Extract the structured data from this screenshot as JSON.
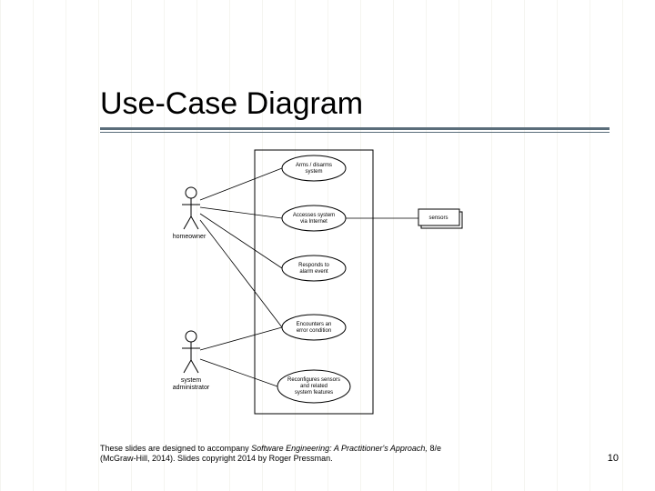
{
  "title": "Use-Case Diagram",
  "actors": {
    "homeowner": "homeowner",
    "sysadmin_line1": "system",
    "sysadmin_line2": "administrator"
  },
  "usecases": {
    "uc1_l1": "Arms / disarms",
    "uc1_l2": "system",
    "uc2_l1": "Accesses system",
    "uc2_l2": "via Internet",
    "uc3_l1": "Responds to",
    "uc3_l2": "alarm event",
    "uc4_l1": "Encounters an",
    "uc4_l2": "error condition",
    "uc5_l1": "Reconfigures sensors",
    "uc5_l2": "and related",
    "uc5_l3": "system features"
  },
  "external": {
    "sensors": "sensors"
  },
  "footer": {
    "line1_a": "These slides are designed to accompany ",
    "line1_b": "Software Engineering: A Practitioner's Approach,",
    "line1_c": " 8/e",
    "line2": "(McGraw-Hill, 2014). Slides copyright 2014 by Roger Pressman."
  },
  "page": "10"
}
